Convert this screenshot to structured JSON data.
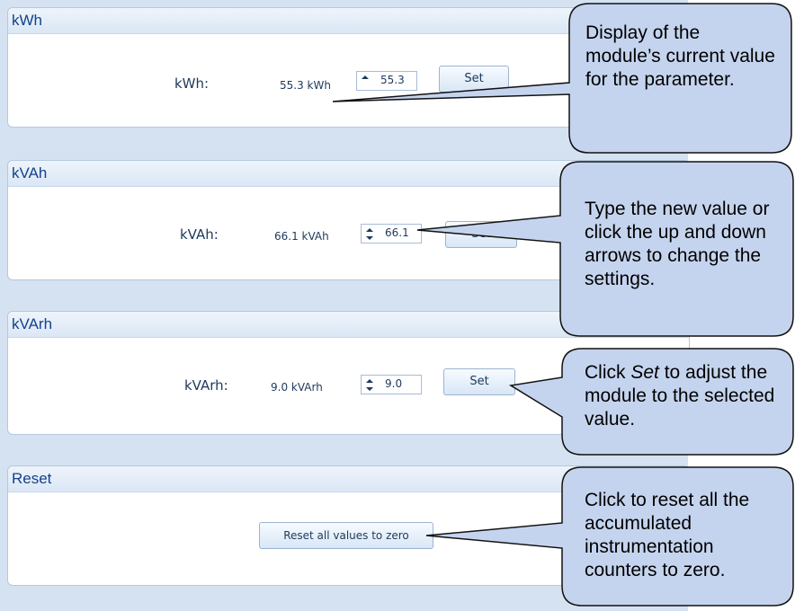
{
  "sections": [
    {
      "title": "kWh",
      "label": "kWh:",
      "display": "55.3 kWh",
      "input": "55.3",
      "button": "Set"
    },
    {
      "title": "kVAh",
      "label": "kVAh:",
      "display": "66.1 kVAh",
      "input": "66.1",
      "button": "Set"
    },
    {
      "title": "kVArh",
      "label": "kVArh:",
      "display": "9.0 kVArh",
      "input": "9.0",
      "button": "Set"
    }
  ],
  "reset": {
    "title": "Reset",
    "button": "Reset all values to zero"
  },
  "callouts": {
    "display": "Display of the module’s current value for the parameter.",
    "type": "Type the new value or click the up and down arrows to change the settings.",
    "set_pre": "Click ",
    "set_em": "Set",
    "set_post": " to adjust the module to the selected value.",
    "reset": "Click to reset all the accumulated instrumentation counters to zero."
  },
  "colors": {
    "panel_bg": "#d5e2f1",
    "header_text": "#15428b",
    "callout_fill": "#c5d4ee"
  }
}
